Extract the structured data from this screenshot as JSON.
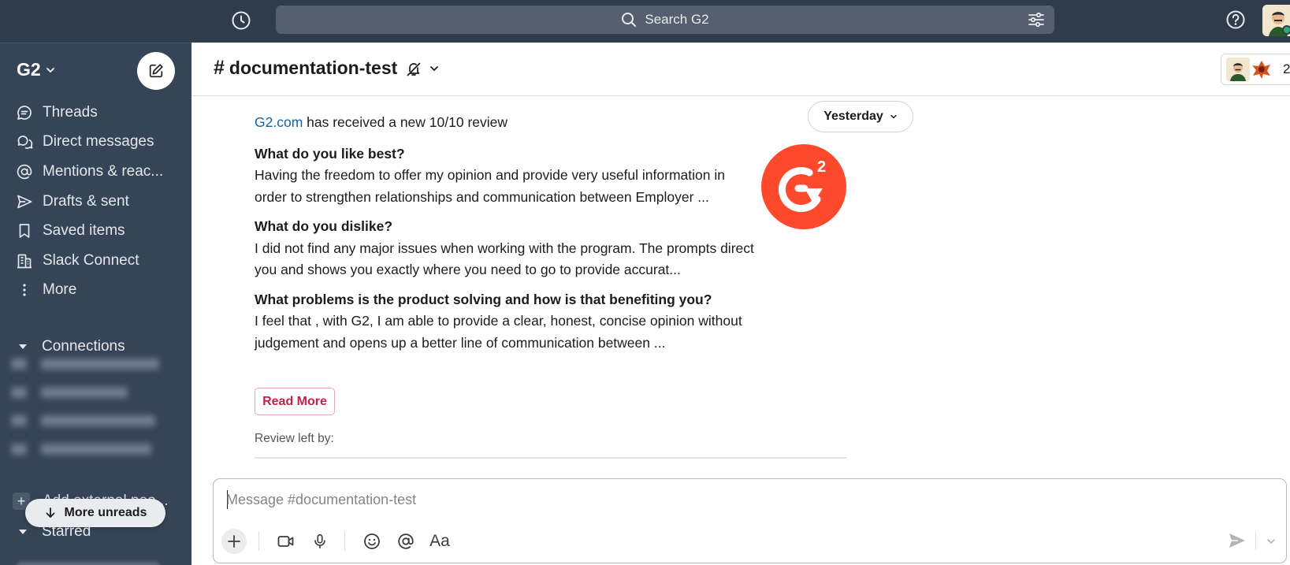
{
  "topbar": {
    "search_placeholder": "Search G2",
    "icons": [
      "history-icon",
      "search-icon",
      "filter-icon",
      "help-icon"
    ]
  },
  "sidebar": {
    "workspace": "G2",
    "nav": [
      {
        "label": "Threads",
        "icon": "threads-icon"
      },
      {
        "label": "Direct messages",
        "icon": "direct-messages-icon"
      },
      {
        "label": "Mentions & reac...",
        "icon": "at-icon"
      },
      {
        "label": "Drafts & sent",
        "icon": "send-icon"
      },
      {
        "label": "Saved items",
        "icon": "bookmark-icon"
      },
      {
        "label": "Slack Connect",
        "icon": "building-icon"
      },
      {
        "label": "More",
        "icon": "more-vertical-icon"
      }
    ],
    "connections_label": "Connections",
    "add_external_label": "Add external peo...",
    "more_unreads_label": "More unreads",
    "starred_label": "Starred"
  },
  "channel": {
    "hash": "#",
    "name": "documentation-test",
    "member_count": "2"
  },
  "message": {
    "date_label": "Yesterday",
    "sender_link": "G2.com",
    "intro_rest": " has received a new 10/10 review",
    "q1": "What do you like best?",
    "a1": "Having the freedom to offer my opinion and provide very useful information in order to strengthen relationships and communication between Employer ...",
    "q2": "What do you dislike?",
    "a2": "I did not find any major issues when working with the program. The prompts direct you and shows you exactly where you need to go to provide accurat...",
    "q3": "What problems is the product solving and how is that benefiting you?",
    "a3": "I feel that , with G2, I am able to provide a clear, honest, concise opinion without judgement and opens up a better line of communication between ...",
    "read_more_label": "Read More",
    "review_by_label": "Review left by:",
    "logo_color": "#ff492c"
  },
  "composer": {
    "placeholder": "Message #documentation-test",
    "format_label": "Aa"
  },
  "colors": {
    "topbar": "#2f3c4c",
    "sidebar": "#354456",
    "link": "#1264a3",
    "read_more": "#c3224a"
  }
}
